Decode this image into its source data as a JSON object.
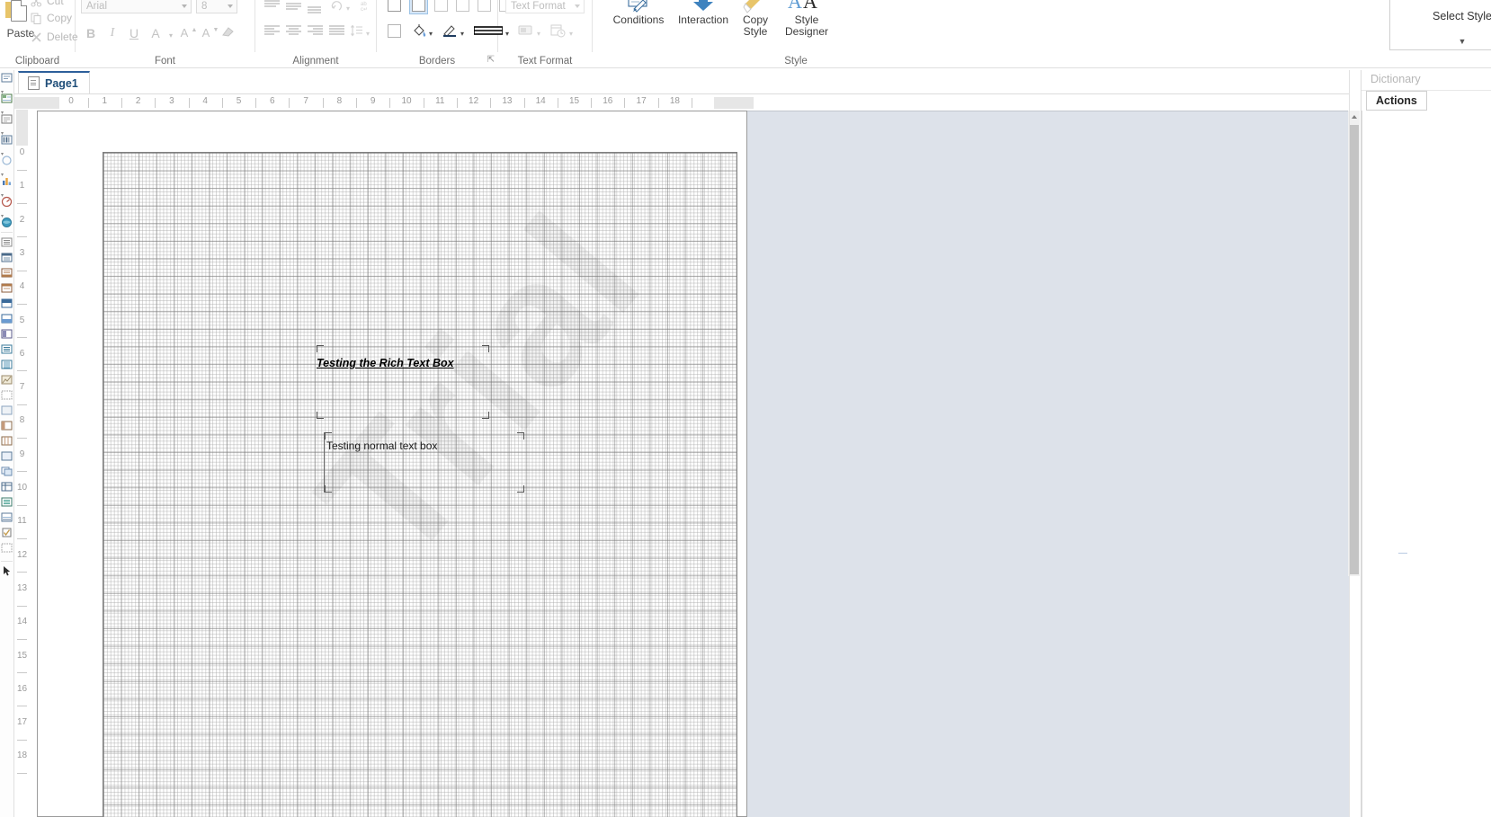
{
  "ribbon": {
    "groups": [
      {
        "id": "clipboard",
        "label": "Clipboard"
      },
      {
        "id": "font",
        "label": "Font"
      },
      {
        "id": "alignment",
        "label": "Alignment"
      },
      {
        "id": "borders",
        "label": "Borders"
      },
      {
        "id": "text_format",
        "label": "Text Format"
      },
      {
        "id": "style",
        "label": "Style"
      }
    ],
    "clipboard": {
      "paste_label": "Paste",
      "paste_icon": "paste-icon",
      "items": [
        {
          "label": "Cut",
          "icon": "scissors-icon"
        },
        {
          "label": "Copy",
          "icon": "copy-icon"
        },
        {
          "label": "Delete",
          "icon": "delete-x-icon"
        }
      ]
    },
    "font": {
      "family_value": "Arial",
      "size_value": "8",
      "bold_label": "B",
      "italic_label": "I",
      "underline_label": "U",
      "font_color_label": "A",
      "grow_label": "A",
      "shrink_label": "A",
      "clear_format_icon": "eraser-icon"
    },
    "alignment": {
      "buttons": [
        "align-top-icon",
        "align-middle-icon",
        "align-bottom-icon",
        "text-rotation-icon",
        "word-wrap-icon",
        "align-left-icon",
        "align-center-icon",
        "align-right-icon",
        "align-justify-icon",
        "line-spacing-icon"
      ]
    },
    "borders": {
      "top_row": [
        "border-all-icon",
        "border-none-icon",
        "border-left-icon",
        "border-top-icon",
        "border-right-icon",
        "border-bottom-icon"
      ],
      "bottom_row": [
        "border-box-icon",
        "border-fill-icon",
        "border-color-icon",
        "border-style-icon"
      ],
      "launcher_icon": "dialog-launcher-icon"
    },
    "text_format": {
      "combo_value": "Text Format",
      "buttons": [
        "text-format-icon",
        "date-format-icon"
      ],
      "launcher_icon": "dialog-launcher-icon"
    },
    "style": {
      "conditions_label": "Conditions",
      "conditions_icon": "conditions-icon",
      "interaction_label": "Interaction",
      "interaction_icon": "interaction-arrow-icon",
      "copy_style_label": "Copy\nStyle",
      "copy_style_line1": "Copy",
      "copy_style_line2": "Style",
      "copy_style_icon": "copy-style-brush-icon",
      "style_designer_line1": "Style",
      "style_designer_line2": "Designer",
      "style_designer_icon": "style-designer-aa-icon",
      "select_style_label": "Select Style",
      "select_style_caret": "▼",
      "launcher_icon": "dialog-launcher-icon"
    }
  },
  "workspace": {
    "tab": {
      "label": "Page1",
      "icon": "page-icon"
    },
    "horizontal_ruler": {
      "ticks": [
        0,
        1,
        2,
        3,
        4,
        5,
        6,
        7,
        8,
        9,
        10,
        11,
        12,
        13,
        14,
        15,
        16,
        17,
        18
      ]
    },
    "vertical_ruler": {
      "ticks": [
        0,
        1,
        2,
        3,
        4,
        5,
        6,
        7,
        8,
        9,
        10,
        11,
        12,
        13,
        14,
        15,
        16,
        17,
        18
      ]
    },
    "watermark_text": "Trial",
    "components": [
      {
        "name": "rich-text-box",
        "text": "Testing the Rich Text Box",
        "selected": true
      },
      {
        "name": "normal-text-box",
        "text": "Testing normal text box",
        "selected": true
      }
    ]
  },
  "right_panel": {
    "dictionary_label": "Dictionary",
    "actions_tab_label": "Actions"
  },
  "colors": {
    "accent": "#1f4e79",
    "tab_top_border": "#2d5f9a",
    "canvas_grey": "#dde2ea",
    "ribbon_disabled": "#c4c4c4"
  }
}
